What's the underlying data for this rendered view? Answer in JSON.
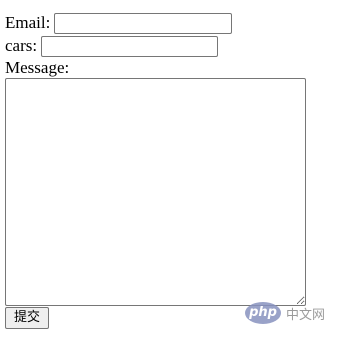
{
  "form": {
    "email_label": "Email:",
    "email_value": "",
    "cars_label": "cars:",
    "cars_value": "",
    "message_label": "Message:",
    "message_value": "",
    "submit_label": "提交"
  },
  "watermark": {
    "logo_text": "php",
    "site_text": "中文网"
  },
  "colors": {
    "input_border": "#767676",
    "button_background": "#efefef",
    "watermark_logo": "#8892bf",
    "watermark_text": "#8a8a8a"
  }
}
